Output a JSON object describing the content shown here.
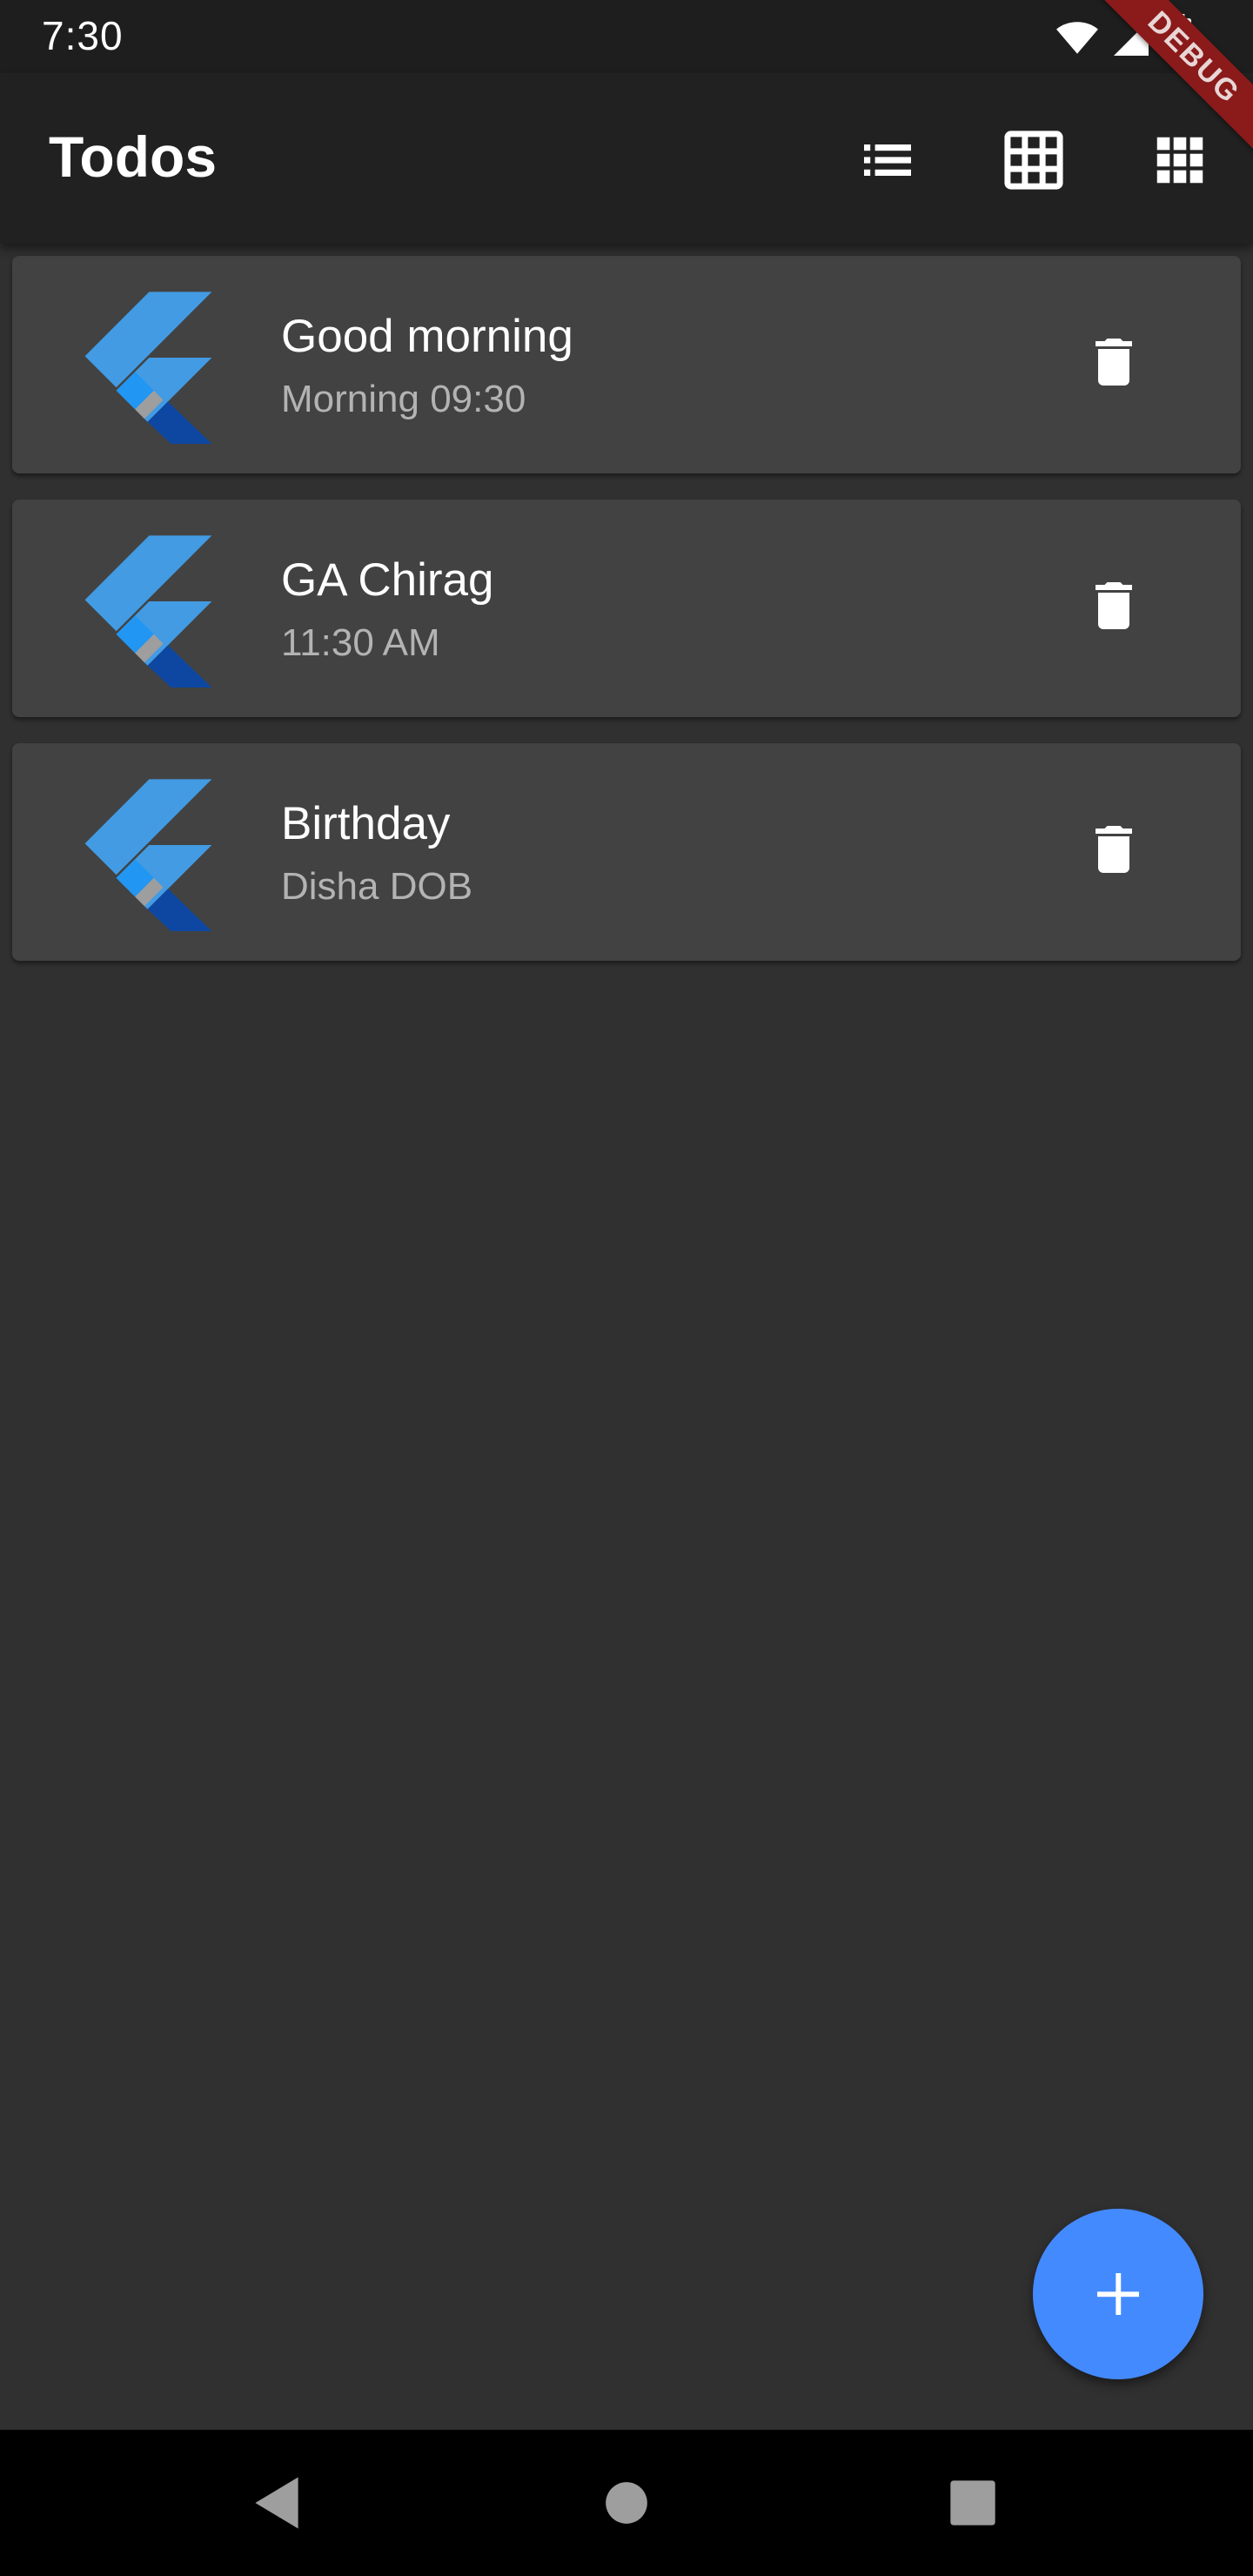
{
  "status_bar": {
    "time": "7:30",
    "icons": [
      "wifi-icon",
      "cellular-signal-icon",
      "battery-charging-icon"
    ]
  },
  "debug_banner": {
    "label": "DEBUG",
    "color": "#8b1a1a"
  },
  "app_bar": {
    "title": "Todos",
    "actions": [
      "list-view-icon",
      "grid-view-icon",
      "dense-grid-view-icon"
    ]
  },
  "todos": [
    {
      "title": "Good morning",
      "subtitle": "Morning 09:30",
      "icon": "flutter-logo-icon",
      "action_icon": "delete-icon"
    },
    {
      "title": "GA Chirag",
      "subtitle": "11:30 AM",
      "icon": "flutter-logo-icon",
      "action_icon": "delete-icon"
    },
    {
      "title": "Birthday",
      "subtitle": "Disha DOB",
      "icon": "flutter-logo-icon",
      "action_icon": "delete-icon"
    }
  ],
  "fab": {
    "icon": "add-icon",
    "color": "#448aff"
  },
  "nav_bar": {
    "buttons": [
      "back-icon",
      "home-icon",
      "recents-icon"
    ]
  },
  "colors": {
    "background": "#303030",
    "app_bar": "#212121",
    "card": "#424242",
    "subtitle": "#b3b3b3"
  }
}
